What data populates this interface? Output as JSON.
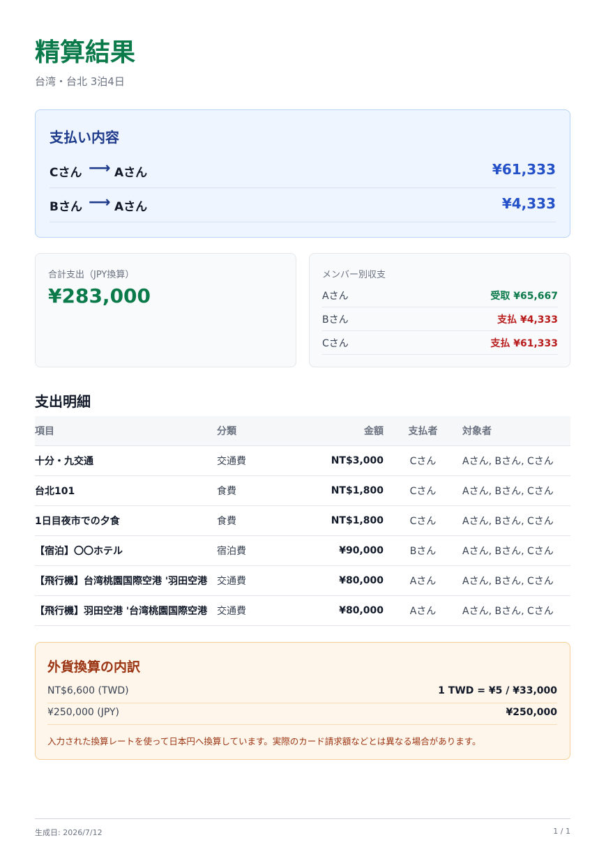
{
  "header": {
    "title": "精算結果",
    "subtitle": "台湾・台北 3泊4日"
  },
  "payments": {
    "title": "支払い内容",
    "arrow": "⟶",
    "rows": [
      {
        "from": "Cさん",
        "to": "Aさん",
        "amount": "¥61,333"
      },
      {
        "from": "Bさん",
        "to": "Aさん",
        "amount": "¥4,333"
      }
    ]
  },
  "summary": {
    "label": "合計支出（JPY換算）",
    "total": "¥283,000"
  },
  "members": {
    "label": "メンバー別収支",
    "rows": [
      {
        "name": "Aさん",
        "status": "受取 ¥65,667",
        "color": "#0b7a4b"
      },
      {
        "name": "Bさん",
        "status": "支払 ¥4,333",
        "color": "#b91c1c"
      },
      {
        "name": "Cさん",
        "status": "支払 ¥61,333",
        "color": "#b91c1c"
      }
    ]
  },
  "expenses": {
    "title": "支出明細",
    "headers": {
      "item": "項目",
      "category": "分類",
      "amount": "金額",
      "payer": "支払者",
      "targets": "対象者"
    },
    "rows": [
      {
        "item": "十分・九交通",
        "category": "交通費",
        "amount": "NT$3,000",
        "payer": "Cさん",
        "targets": "Aさん, Bさん, Cさん"
      },
      {
        "item": "台北101",
        "category": "食費",
        "amount": "NT$1,800",
        "payer": "Cさん",
        "targets": "Aさん, Bさん, Cさん"
      },
      {
        "item": "1日目夜市での夕食",
        "category": "食費",
        "amount": "NT$1,800",
        "payer": "Cさん",
        "targets": "Aさん, Bさん, Cさん"
      },
      {
        "item": "【宿泊】〇〇ホテル",
        "category": "宿泊費",
        "amount": "¥90,000",
        "payer": "Bさん",
        "targets": "Aさん, Bさん, Cさん"
      },
      {
        "item": "【飛行機】台湾桃園国際空港 '羽田空港",
        "category": "交通費",
        "amount": "¥80,000",
        "payer": "Aさん",
        "targets": "Aさん, Bさん, Cさん"
      },
      {
        "item": "【飛行機】羽田空港 '台湾桃園国際空港",
        "category": "交通費",
        "amount": "¥80,000",
        "payer": "Aさん",
        "targets": "Aさん, Bさん, Cさん"
      }
    ]
  },
  "fx": {
    "title": "外貨換算の内訳",
    "rows": [
      {
        "currency": "NT$6,600 (TWD)",
        "rate": "1 TWD = ¥5 / ¥33,000"
      },
      {
        "currency": "¥250,000 (JPY)",
        "rate": "¥250,000"
      }
    ],
    "note": "入力された換算レートを使って日本円へ換算しています。実際のカード請求額などとは異なる場合があります。"
  },
  "footer": {
    "generated": "生成日: 2026/7/12",
    "page": "1 / 1"
  }
}
